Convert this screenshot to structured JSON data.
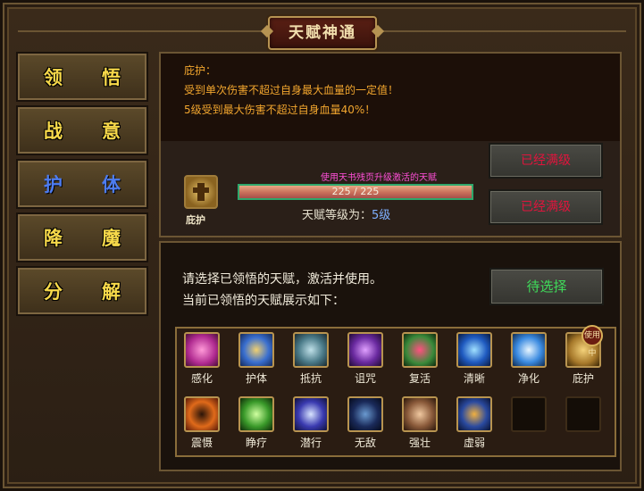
{
  "window": {
    "title": "天赋神通"
  },
  "sidebar": {
    "items": [
      {
        "label_a": "领",
        "label_b": "悟",
        "active": false
      },
      {
        "label_a": "战",
        "label_b": "意",
        "active": false
      },
      {
        "label_a": "护",
        "label_b": "体",
        "active": true
      },
      {
        "label_a": "降",
        "label_b": "魔",
        "active": false
      },
      {
        "label_a": "分",
        "label_b": "解",
        "active": false
      }
    ]
  },
  "detail": {
    "name_line": "庇护：",
    "desc_line1": "受到单次伤害不超过自身最大血量的一定值！",
    "desc_line2": "5级受到最大伤害不超过自身血量40%！",
    "skill_label": "庇护",
    "progress_hint": "使用天书残页升级激活的天赋",
    "progress_text": "225 / 225",
    "progress_fraction": 1.0,
    "level_prefix": "天赋等级为：",
    "level_value": "5级",
    "button_1": "已经满级",
    "button_2": "已经满级"
  },
  "activation": {
    "line1": "请选择已领悟的天赋，激活并使用。",
    "line2": "当前已领悟的天赋展示如下：",
    "pending_button": "待选择"
  },
  "talents": {
    "row1": [
      {
        "label": "感化",
        "icon": "heart-icon"
      },
      {
        "label": "护体",
        "icon": "shield-cross-icon"
      },
      {
        "label": "抵抗",
        "icon": "armor-icon"
      },
      {
        "label": "诅咒",
        "icon": "curse-icon"
      },
      {
        "label": "复活",
        "icon": "revive-heart-icon"
      },
      {
        "label": "清晰",
        "icon": "water-drop-icon"
      },
      {
        "label": "净化",
        "icon": "purify-icon"
      },
      {
        "label": "庇护",
        "icon": "shield-ankh-icon",
        "badge": "使用中"
      }
    ],
    "row2": [
      {
        "label": "震慑",
        "icon": "flame-ring-icon"
      },
      {
        "label": "睁疗",
        "icon": "leaf-heal-icon"
      },
      {
        "label": "潜行",
        "icon": "stealth-icon"
      },
      {
        "label": "无敌",
        "icon": "dark-shield-icon"
      },
      {
        "label": "强壮",
        "icon": "fist-icon"
      },
      {
        "label": "虚弱",
        "icon": "weak-figure-icon"
      },
      {
        "label": "",
        "icon": "empty-slot"
      },
      {
        "label": "",
        "icon": "empty-slot"
      }
    ]
  },
  "colors": {
    "gold_text": "#f7d94a",
    "active_blue": "#4d7cf0",
    "desc_orange": "#f2a62e",
    "maxed_red": "#e0143c",
    "pending_green": "#3fdc5a",
    "progress_border": "#2fa76b"
  }
}
